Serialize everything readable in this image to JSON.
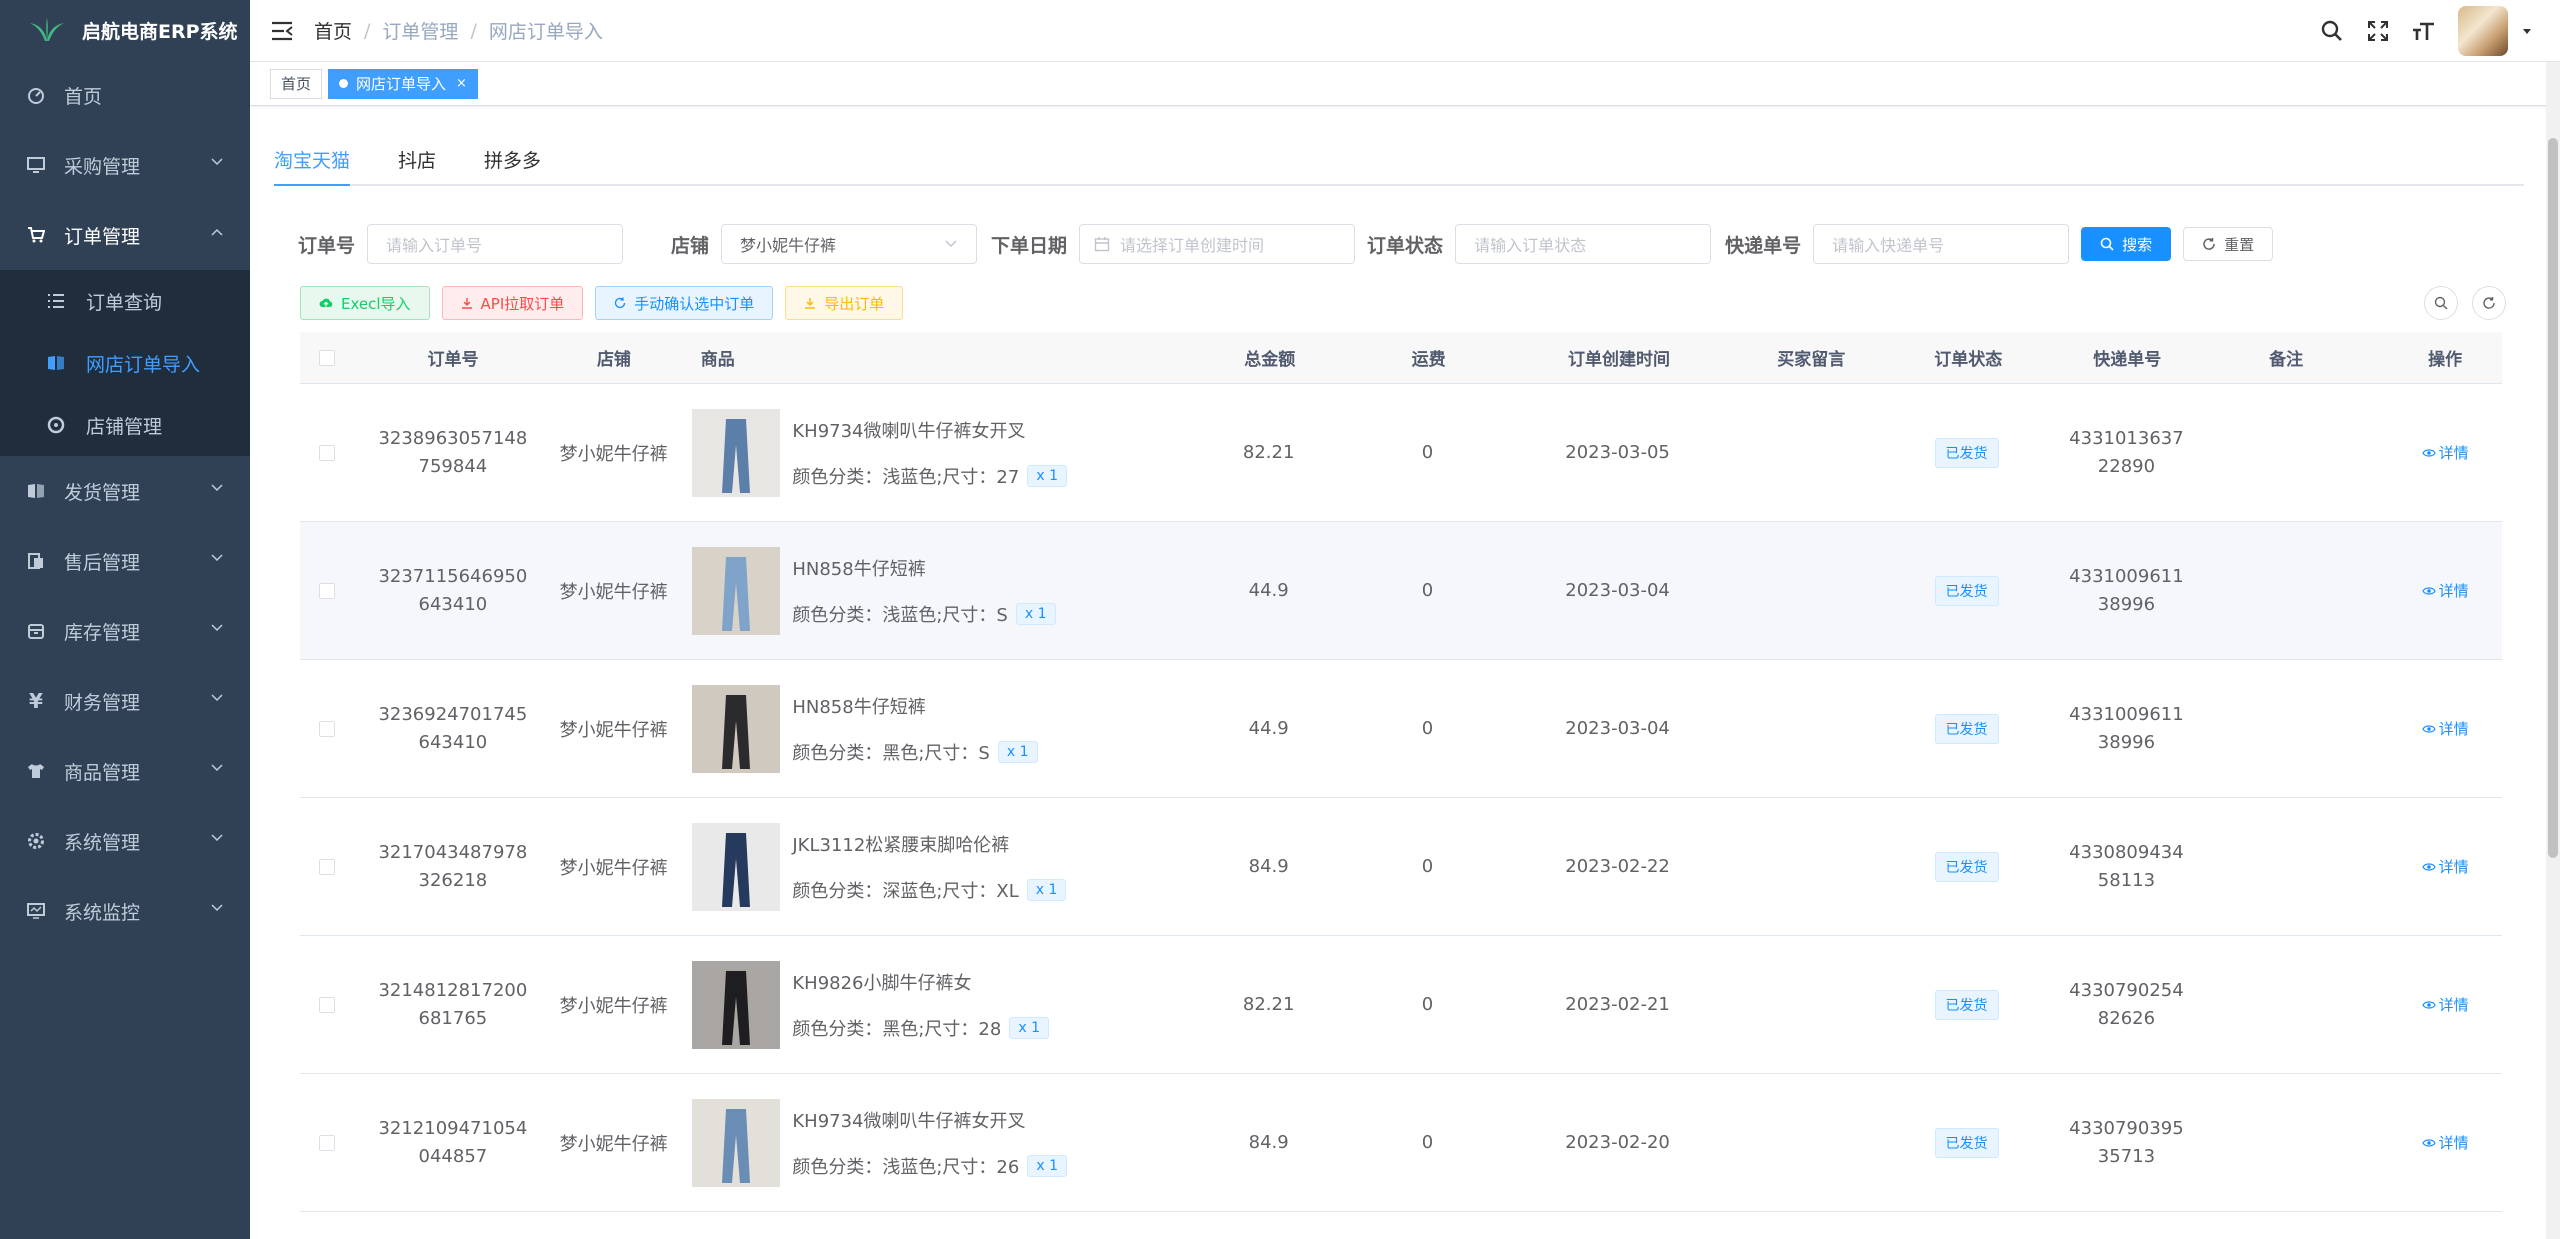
{
  "app": {
    "title": "启航电商ERP系统"
  },
  "sidebar": {
    "items": [
      {
        "label": "首页",
        "icon": "dashboard-icon"
      },
      {
        "label": "采购管理",
        "icon": "monitor-icon"
      },
      {
        "label": "订单管理",
        "icon": "cart-icon"
      },
      {
        "label": "发货管理",
        "icon": "book-icon"
      },
      {
        "label": "售后管理",
        "icon": "clipboard-icon"
      },
      {
        "label": "库存管理",
        "icon": "box-icon"
      },
      {
        "label": "财务管理",
        "icon": "yen-icon"
      },
      {
        "label": "商品管理",
        "icon": "shirt-icon"
      },
      {
        "label": "系统管理",
        "icon": "gear-icon"
      },
      {
        "label": "系统监控",
        "icon": "monitor-icon"
      }
    ],
    "submenu": [
      {
        "label": "订单查询",
        "icon": "list-icon"
      },
      {
        "label": "网店订单导入",
        "icon": "import-icon"
      },
      {
        "label": "店铺管理",
        "icon": "shop-icon"
      }
    ]
  },
  "breadcrumb": [
    "首页",
    "订单管理",
    "网店订单导入"
  ],
  "tags": [
    {
      "label": "首页"
    },
    {
      "label": "网店订单导入",
      "close": "×"
    }
  ],
  "tabs": [
    "淘宝天猫",
    "抖店",
    "拼多多"
  ],
  "search": {
    "order_label": "订单号",
    "order_placeholder": "请输入订单号",
    "shop_label": "店铺",
    "shop_value": "梦小妮牛仔裤",
    "date_label": "下单日期",
    "date_placeholder": "请选择订单创建时间",
    "status_label": "订单状态",
    "status_placeholder": "请输入订单状态",
    "express_label": "快递单号",
    "express_placeholder": "请输入快递单号",
    "search_btn": "搜索",
    "reset_btn": "重置"
  },
  "toolbar": {
    "excel": "Execl导入",
    "api": "API拉取订单",
    "confirm": "手动确认选中订单",
    "export": "导出订单"
  },
  "table": {
    "headers": [
      "订单号",
      "店铺",
      "商品",
      "总金额",
      "运费",
      "订单创建时间",
      "买家留言",
      "订单状态",
      "快递单号",
      "备注",
      "操作"
    ],
    "rows": [
      {
        "order": "3238963057148759844",
        "shop": "梦小妮牛仔裤",
        "title": "KH9734微喇叭牛仔裤女开叉",
        "sku": "颜色分类：浅蓝色;尺寸：27",
        "qty": "x 1",
        "total": "82.21",
        "ship": "0",
        "time": "2023-03-05",
        "msg": "",
        "status": "已发货",
        "express": "433101363722890",
        "note": "",
        "op": "详情"
      },
      {
        "order": "3237115646950643410",
        "shop": "梦小妮牛仔裤",
        "title": "HN858牛仔短裤",
        "sku": "颜色分类：浅蓝色;尺寸：S",
        "qty": "x 1",
        "total": "44.9",
        "ship": "0",
        "time": "2023-03-04",
        "msg": "",
        "status": "已发货",
        "express": "433100961138996",
        "note": "",
        "op": "详情"
      },
      {
        "order": "3236924701745643410",
        "shop": "梦小妮牛仔裤",
        "title": "HN858牛仔短裤",
        "sku": "颜色分类：黑色;尺寸：S",
        "qty": "x 1",
        "total": "44.9",
        "ship": "0",
        "time": "2023-03-04",
        "msg": "",
        "status": "已发货",
        "express": "433100961138996",
        "note": "",
        "op": "详情"
      },
      {
        "order": "3217043487978326218",
        "shop": "梦小妮牛仔裤",
        "title": "JKL3112松紧腰束脚哈伦裤",
        "sku": "颜色分类：深蓝色;尺寸：XL",
        "qty": "x 1",
        "total": "84.9",
        "ship": "0",
        "time": "2023-02-22",
        "msg": "",
        "status": "已发货",
        "express": "433080943458113",
        "note": "",
        "op": "详情"
      },
      {
        "order": "3214812817200681765",
        "shop": "梦小妮牛仔裤",
        "title": "KH9826小脚牛仔裤女",
        "sku": "颜色分类：黑色;尺寸：28",
        "qty": "x 1",
        "total": "82.21",
        "ship": "0",
        "time": "2023-02-21",
        "msg": "",
        "status": "已发货",
        "express": "433079025482626",
        "note": "",
        "op": "详情"
      },
      {
        "order": "3212109471054044857",
        "shop": "梦小妮牛仔裤",
        "title": "KH9734微喇叭牛仔裤女开叉",
        "sku": "颜色分类：浅蓝色;尺寸：26",
        "qty": "x 1",
        "total": "84.9",
        "ship": "0",
        "time": "2023-02-20",
        "msg": "",
        "status": "已发货",
        "express": "433079039535713",
        "note": "",
        "op": "详情"
      }
    ]
  },
  "colors": {
    "primary": "#1890ff",
    "sidebar": "#304156",
    "submenu": "#1f2d3d"
  }
}
